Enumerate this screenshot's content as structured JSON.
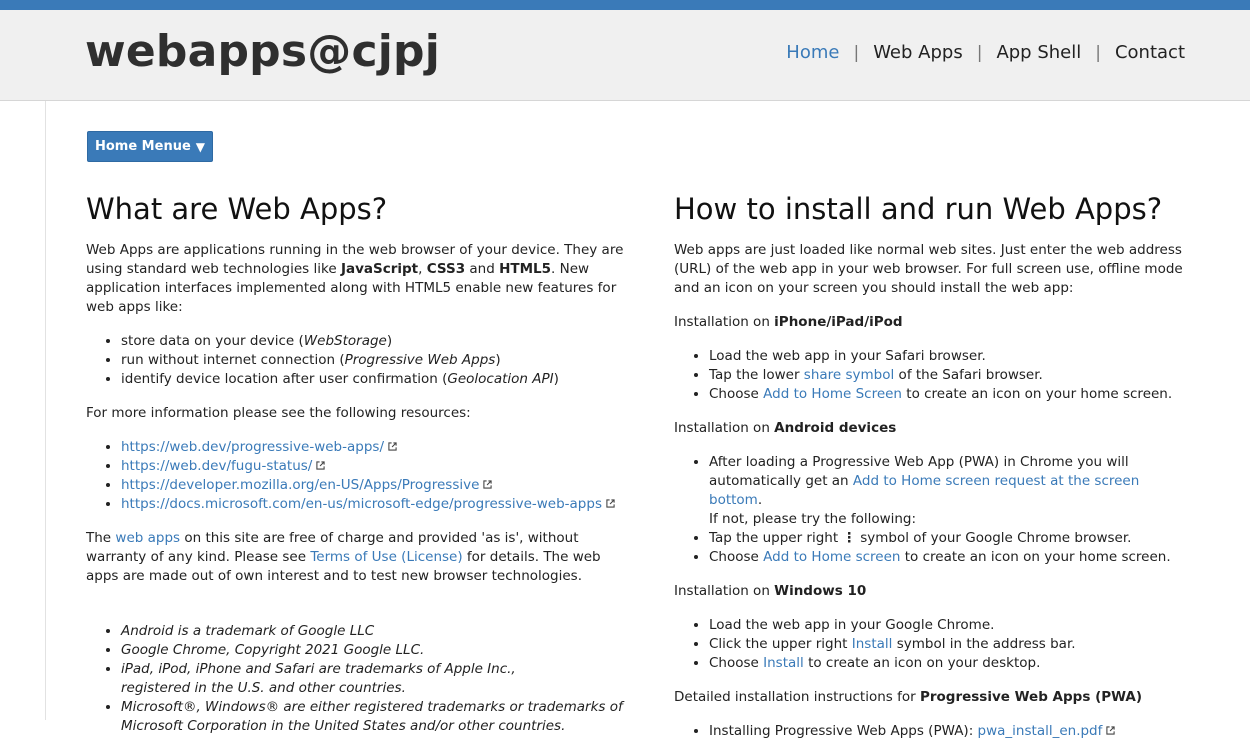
{
  "header": {
    "brand": "webapps@cjpj",
    "nav": [
      {
        "label": "Home",
        "active": true
      },
      {
        "label": "Web Apps",
        "active": false
      },
      {
        "label": "App Shell",
        "active": false
      },
      {
        "label": "Contact",
        "active": false
      }
    ],
    "separator": "|"
  },
  "menu_button": {
    "label": "Home Menue",
    "arrow": "▼"
  },
  "left": {
    "title": "What are Web Apps?",
    "intro_1": "Web Apps are applications running in the web browser of your device. They are using standard web technologies like ",
    "js": "JavaScript",
    "comma": ", ",
    "css": "CSS3",
    "and": " and ",
    "html": "HTML5",
    "intro_2": ". New application interfaces implemented along with HTML5 enable new features for web apps like:",
    "features": [
      {
        "text": "store data on your device (",
        "em": "WebStorage",
        "end": ")"
      },
      {
        "text": "run without internet connection (",
        "em": "Progressive Web Apps",
        "end": ")"
      },
      {
        "text": "identify device location after user confirmation (",
        "em": "Geolocation API",
        "end": ")"
      }
    ],
    "resources_intro": "For more information please see the following resources:",
    "resources": [
      "https://web.dev/progressive-web-apps/",
      "https://web.dev/fugu-status/",
      "https://developer.mozilla.org/en-US/Apps/Progressive",
      "https://docs.microsoft.com/en-us/microsoft-edge/progressive-web-apps"
    ],
    "free_1": "The ",
    "free_link": "web apps",
    "free_2": " on this site are free of charge and provided 'as is', without warranty of any kind. Please see ",
    "terms_link": "Terms of Use (License)",
    "free_3": " for details. The web apps are made out of own interest and to test new browser technologies.",
    "trademarks": [
      "Android is a trademark of Google LLC",
      "Google Chrome, Copyright 2021 Google LLC.",
      "iPad, iPod, iPhone and Safari are trademarks of Apple Inc.,",
      "registered in the U.S. and other countries.",
      "Microsoft®, Windows® are either registered trademarks or trademarks of",
      "Microsoft Corporation in the United States and/or other countries."
    ]
  },
  "right": {
    "title": "How to install and run Web Apps?",
    "intro": "Web apps are just loaded like normal web sites. Just enter the web address (URL) of the web app in your web browser. For full screen use, offline mode and an icon on your screen you should install the web app:",
    "installation_on": "Installation on ",
    "ios_heading": "iPhone/iPad/iPod",
    "ios_1": "Load the web app in your Safari browser.",
    "ios_2a": "Tap the lower ",
    "ios_2link": "share symbol",
    "ios_2b": " of the Safari browser.",
    "ios_3a": "Choose ",
    "ios_3link": "Add to Home Screen",
    "ios_3b": " to create an icon on your home screen.",
    "android_heading": "Android devices",
    "android_1a": "After loading a Progressive Web App (PWA) in Chrome you will automatically get an ",
    "android_1link": "Add to Home screen request at the screen bottom",
    "android_1b": ".",
    "android_1c": "If not, please try the following:",
    "android_2a": "Tap the upper right ",
    "android_2sym": "⋮",
    "android_2b": " symbol of your Google Chrome browser.",
    "android_3a": "Choose ",
    "android_3link": "Add to Home screen",
    "android_3b": " to create an icon on your home screen.",
    "win_heading": "Windows 10",
    "win_1": "Load the web app in your Google Chrome.",
    "win_2a": "Click the upper right ",
    "win_2link": "Install",
    "win_2b": " symbol in the address bar.",
    "win_3a": "Choose ",
    "win_3link": "Install",
    "win_3b": " to create an icon on your desktop.",
    "detail_a": "Detailed installation instructions for ",
    "detail_b": "Progressive Web Apps (PWA)",
    "pdf_a": "Installing Progressive Web Apps (PWA): ",
    "pdf_link": "pwa_install_en.pdf"
  },
  "colors": {
    "accent": "#3a7ab8",
    "header_bg": "#f0f0f0",
    "text": "#222222"
  },
  "icons": {
    "external_link": "external-link-icon",
    "dropdown": "triangle-down-icon"
  }
}
